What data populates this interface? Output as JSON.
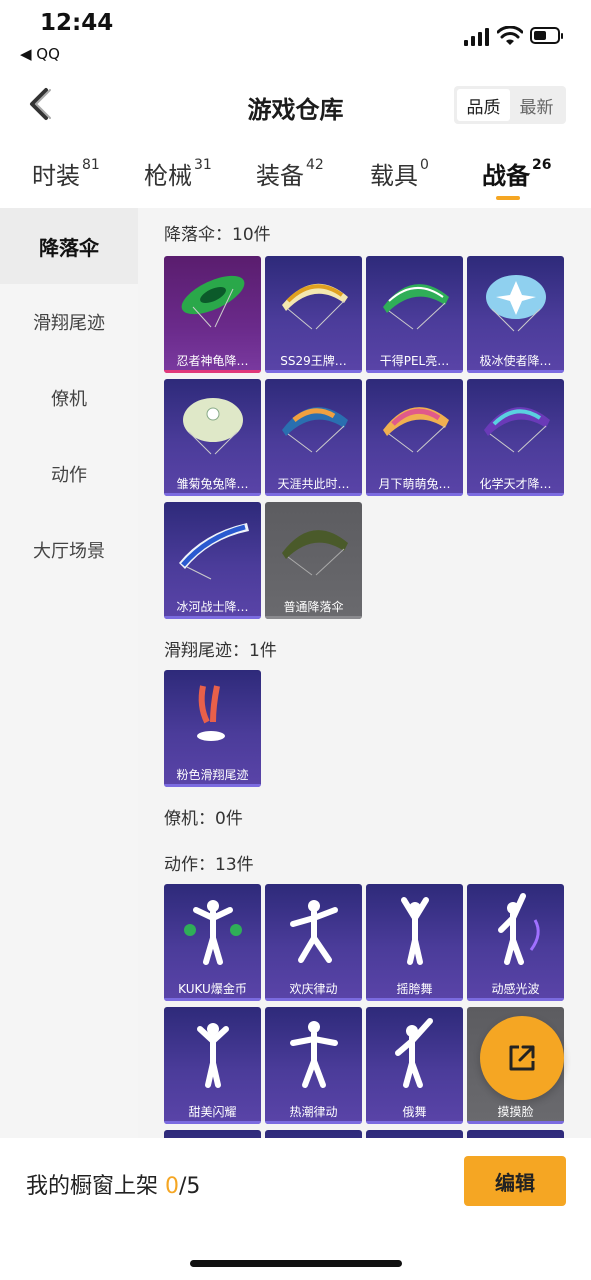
{
  "status": {
    "time": "12:44",
    "back_app": "◀ QQ"
  },
  "nav": {
    "title": "游戏仓库",
    "sort_options": [
      "品质",
      "最新"
    ]
  },
  "tabs": [
    {
      "label": "时装",
      "count": "81"
    },
    {
      "label": "枪械",
      "count": "31"
    },
    {
      "label": "装备",
      "count": "42"
    },
    {
      "label": "载具",
      "count": "0"
    },
    {
      "label": "战备",
      "count": "26"
    }
  ],
  "sidebar": {
    "items": [
      "降落伞",
      "滑翔尾迹",
      "僚机",
      "动作",
      "大厅场景"
    ]
  },
  "sections": {
    "parachute": {
      "heading": "降落伞：10件",
      "items": [
        "忍者神龟降…",
        "SS29王牌…",
        "干得PEL亮…",
        "极冰使者降…",
        "雏菊兔兔降…",
        "天涯共此时…",
        "月下萌萌兔…",
        "化学天才降…",
        "冰河战士降…",
        "普通降落伞"
      ]
    },
    "trail": {
      "heading": "滑翔尾迹：1件",
      "items": [
        "粉色滑翔尾迹"
      ]
    },
    "wingman": {
      "heading": "僚机：0件"
    },
    "emote": {
      "heading": "动作：13件",
      "items": [
        "KUKU爆金币",
        "欢庆律动",
        "摇胯舞",
        "动感光波",
        "甜美闪耀",
        "热潮律动",
        "俄舞",
        "摸摸脸"
      ]
    }
  },
  "bottom": {
    "label": "我的橱窗上架",
    "count": "0",
    "total": "/5",
    "edit": "编辑"
  },
  "colors": {
    "accent": "#f5a623",
    "card_purple": "#4b3c9a",
    "card_pink_bar": "#e0397a"
  }
}
